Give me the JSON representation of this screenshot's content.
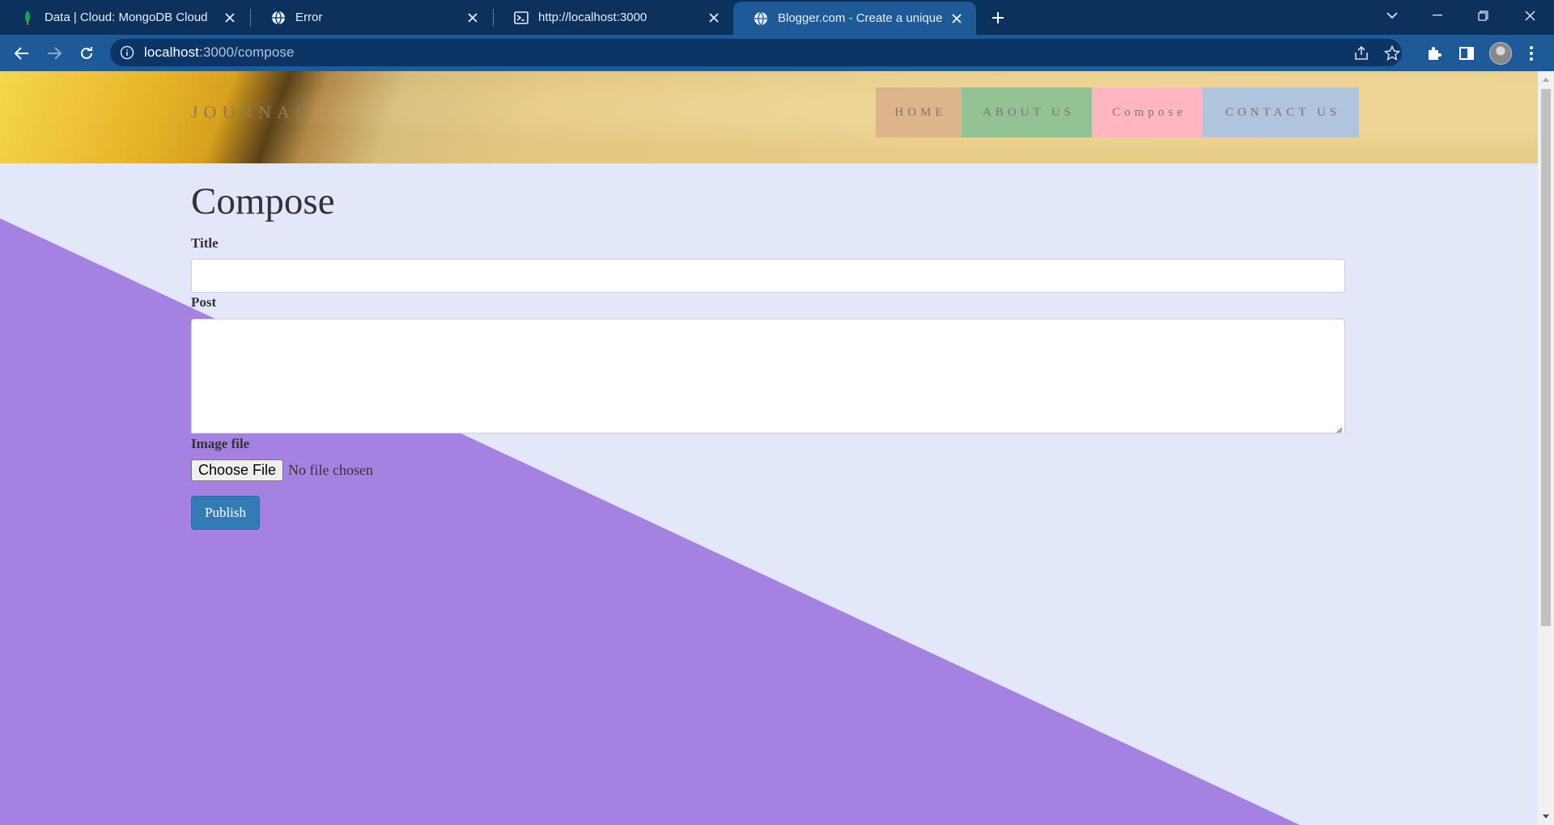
{
  "browser": {
    "tabs": [
      {
        "title": "Data | Cloud: MongoDB Cloud",
        "icon": "mongodb-leaf-icon",
        "active": false
      },
      {
        "title": "Error",
        "icon": "globe-icon",
        "active": false
      },
      {
        "title": "http://localhost:3000",
        "icon": "terminal-icon",
        "active": false
      },
      {
        "title": "Blogger.com - Create a unique and beautiful blog",
        "icon": "globe-icon",
        "active": true
      }
    ],
    "address": {
      "host": "localhost",
      "path": ":3000/compose"
    }
  },
  "site": {
    "brand": "JOURNAL",
    "nav": [
      {
        "label": "HOME",
        "color": "#dcb68a"
      },
      {
        "label": "ABOUT US",
        "color": "#93c295"
      },
      {
        "label": "Compose",
        "color": "#ffb6c1"
      },
      {
        "label": "CONTACT US",
        "color": "#b0c4de"
      }
    ]
  },
  "compose": {
    "heading": "Compose",
    "title_label": "Title",
    "title_value": "",
    "post_label": "Post",
    "post_value": "",
    "image_label": "Image file",
    "choose_file_label": "Choose File",
    "no_file_text": "No file chosen",
    "publish_label": "Publish"
  },
  "colors": {
    "page_bg": "#e2e8fa",
    "diagonal_accent": "#a582e2",
    "publish_button": "#337ab7",
    "tabbar": "#0b325c",
    "toolbar": "#1e5a98"
  }
}
